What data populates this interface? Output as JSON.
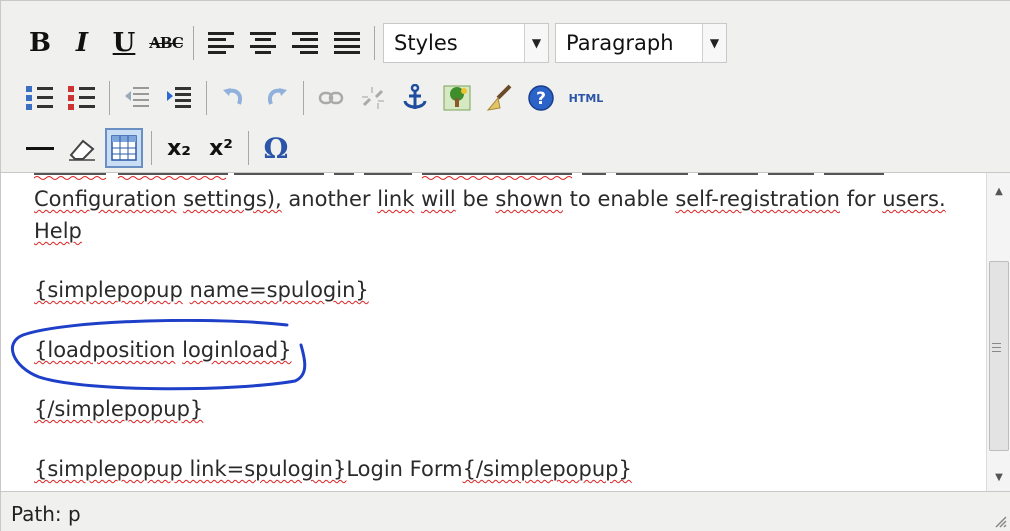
{
  "toolbar": {
    "row1": {
      "bold": "B",
      "italic": "I",
      "underline": "U",
      "strikethrough": "ABC",
      "styles_select": "Styles",
      "format_select": "Paragraph"
    },
    "row2": {
      "html_button": "HTML"
    },
    "row3": {
      "subscript": "x₂",
      "superscript": "x²",
      "special_char": "Ω"
    }
  },
  "content": {
    "line_partial": "Configuration settings), another link will be shown to enable self-registration for users.",
    "help_link": "Help",
    "line1": "{simplepopup name=spulogin}",
    "line2": "{loadposition loginload}",
    "line3": "{/simplepopup}",
    "line4_code": "{simplepopup link=spulogin}",
    "line4_text": "Login Form",
    "line4_close": "{/simplepopup}"
  },
  "statusbar": {
    "path_label": "Path: p"
  },
  "colors": {
    "toolbar_bg": "#f0f0ee",
    "link": "#1a55c0",
    "annotation": "#1e3fc8",
    "spellcheck": "#dd2222"
  }
}
